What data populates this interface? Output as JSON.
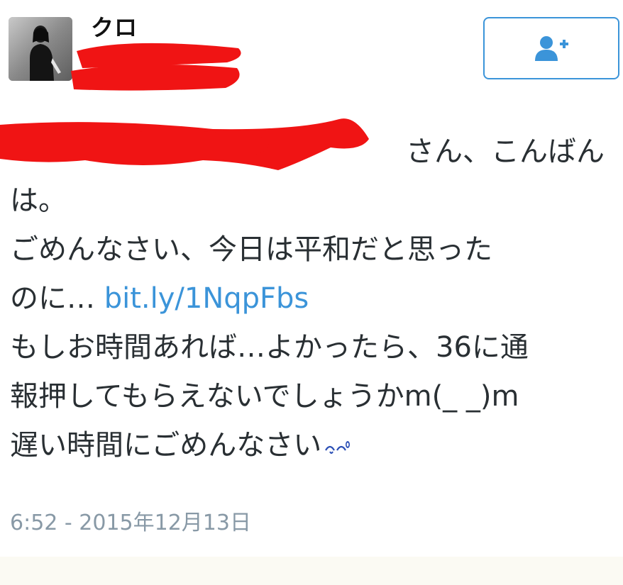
{
  "author": {
    "display_name": "クロ"
  },
  "follow_button": {
    "icon": "user-plus-icon",
    "color": "#3b94d9"
  },
  "tweet": {
    "line_1": "さん、こんばん",
    "line_2": "は。",
    "line_3": "ごめんなさい、今日は平和だと思った",
    "line_4_text": "のに…",
    "link": "bit.ly/1NqpFbs",
    "line_5": "もしお時間あれば…よかったら、36に通",
    "line_6": "報押してもらえないでしょうかm(_ _)m",
    "line_7": "遅い時間にごめんなさい",
    "emoji": "sweat-drop-icon"
  },
  "timestamp": "6:52 - 2015年12月13日",
  "colors": {
    "accent": "#3b94d9",
    "text": "#292f33",
    "muted": "#8899a6",
    "redaction": "#f01414"
  }
}
